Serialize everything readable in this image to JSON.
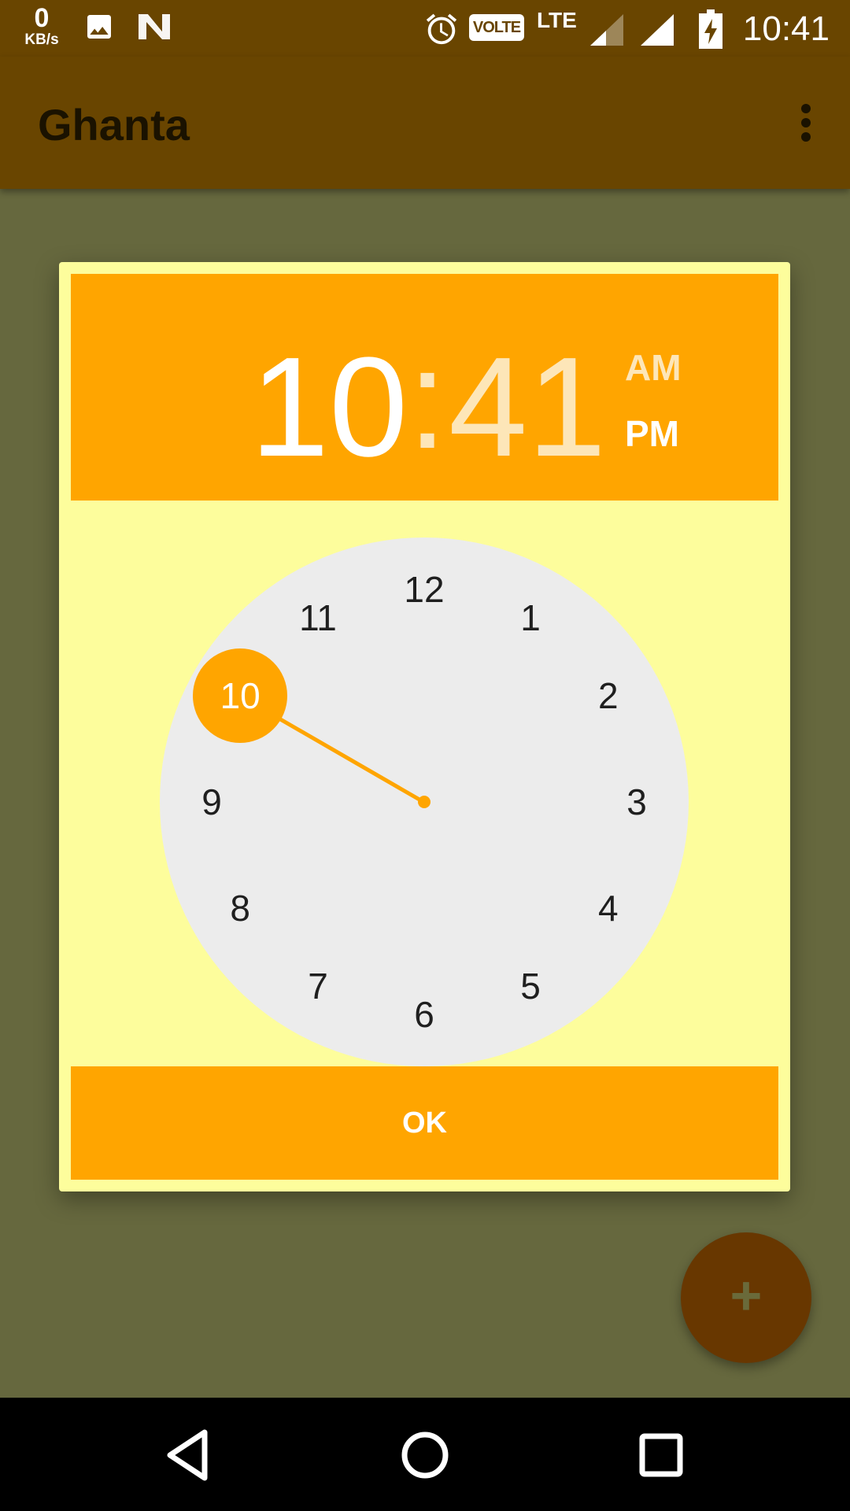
{
  "status_bar": {
    "speed_value": "0",
    "speed_unit": "KB/s",
    "network": "LTE",
    "volte": "VOLTE",
    "time": "10:41",
    "icons": [
      "image-icon",
      "n-logo-icon",
      "alarm-icon",
      "signal-icon",
      "battery-charging-icon"
    ]
  },
  "app_bar": {
    "title": "Ghanta",
    "menu_icon": "more-vert-icon"
  },
  "time_picker": {
    "hour": "10",
    "separator": ":",
    "minute": "41",
    "am_label": "AM",
    "pm_label": "PM",
    "selected_period": "PM",
    "selected_hour": "10",
    "clock_numbers": [
      "12",
      "1",
      "2",
      "3",
      "4",
      "5",
      "6",
      "7",
      "8",
      "9",
      "10",
      "11"
    ],
    "ok_label": "OK"
  },
  "fab": {
    "label": "+",
    "icon": "add-icon"
  },
  "nav_bar": {
    "icons": [
      "back-icon",
      "home-icon",
      "recents-icon"
    ]
  },
  "colors": {
    "accent": "#ffa500",
    "app_bar": "#694500",
    "dialog_bg": "#fdfd9c",
    "clock_face": "#ececec",
    "scrim": "#66683e"
  }
}
